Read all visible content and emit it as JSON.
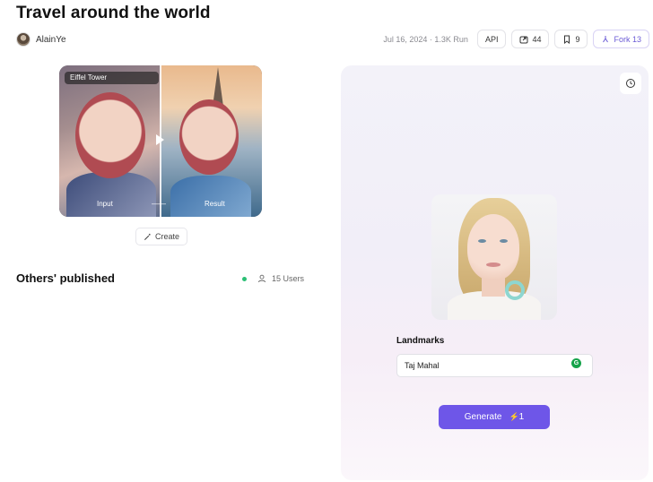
{
  "page": {
    "title": "Travel around the world"
  },
  "author": {
    "name": "AlainYe"
  },
  "meta": {
    "info": "Jul 16, 2024 · 1.3K Run",
    "api_label": "API",
    "shares": "44",
    "saves": "9",
    "fork_label": "Fork 13"
  },
  "preview": {
    "tag": "Eiffel Tower",
    "input_label": "Input",
    "arrow": "——",
    "result_label": "Result"
  },
  "create_label": "Create",
  "others": {
    "title": "Others' published",
    "users": "15 Users"
  },
  "form": {
    "landmarks_label": "Landmarks",
    "landmarks_value": "Taj Mahal",
    "generate_label": "Generate",
    "cost": "1"
  },
  "colors": {
    "accent": "#6e56e8",
    "online": "#2bbf75"
  }
}
